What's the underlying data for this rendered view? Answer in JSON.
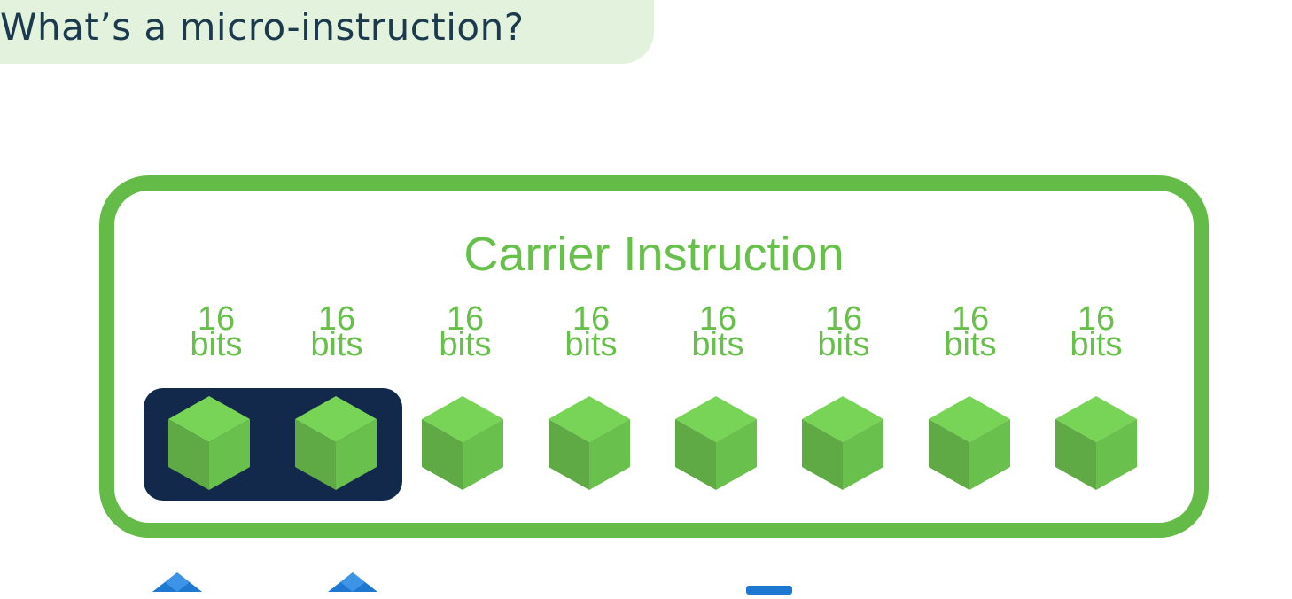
{
  "header": {
    "title": "What’s a micro-instruction?"
  },
  "diagram": {
    "carrier_label": "Carrier Instruction",
    "segments": [
      {
        "top": "16",
        "bottom": "bits",
        "highlighted": true
      },
      {
        "top": "16",
        "bottom": "bits",
        "highlighted": true
      },
      {
        "top": "16",
        "bottom": "bits",
        "highlighted": false
      },
      {
        "top": "16",
        "bottom": "bits",
        "highlighted": false
      },
      {
        "top": "16",
        "bottom": "bits",
        "highlighted": false
      },
      {
        "top": "16",
        "bottom": "bits",
        "highlighted": false
      },
      {
        "top": "16",
        "bottom": "bits",
        "highlighted": false
      },
      {
        "top": "16",
        "bottom": "bits",
        "highlighted": false
      }
    ]
  },
  "colors": {
    "title_bg": "#e3f2dc",
    "title_text": "#1b3a4e",
    "carrier_border": "#64bb47",
    "carrier_text": "#67c04a",
    "highlight_bg": "#12294c",
    "cube_top": "#78d456",
    "cube_left": "#5faa45",
    "cube_right": "#6ac04c",
    "bottom_icon": "#1e78d2"
  },
  "bottom_icons": [
    {
      "name": "blue-diamond-icon"
    },
    {
      "name": "blue-diamond-icon"
    },
    {
      "name": "blue-square-icon"
    }
  ]
}
